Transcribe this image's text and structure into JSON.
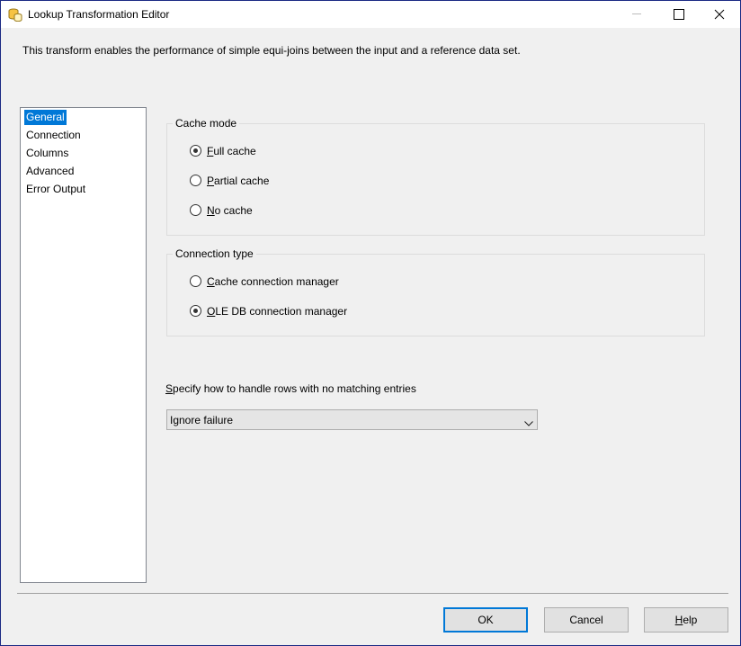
{
  "window": {
    "title": "Lookup Transformation Editor"
  },
  "description": "This transform enables the performance of simple equi-joins between the input and a reference data set.",
  "nav": {
    "items": [
      {
        "label": "General",
        "selected": true
      },
      {
        "label": "Connection",
        "selected": false
      },
      {
        "label": "Columns",
        "selected": false
      },
      {
        "label": "Advanced",
        "selected": false
      },
      {
        "label": "Error Output",
        "selected": false
      }
    ]
  },
  "cache_mode": {
    "legend": "Cache mode",
    "options": [
      {
        "label": "Full cache",
        "checked": true
      },
      {
        "label": "Partial cache",
        "checked": false
      },
      {
        "label": "No cache",
        "checked": false
      }
    ]
  },
  "connection_type": {
    "legend": "Connection type",
    "options": [
      {
        "label": "Cache connection manager",
        "checked": false
      },
      {
        "label": "OLE DB connection manager",
        "checked": true
      }
    ]
  },
  "no_match": {
    "label": "Specify how to handle rows with no matching entries",
    "value": "Ignore failure"
  },
  "buttons": {
    "ok": "OK",
    "cancel": "Cancel",
    "help": "Help"
  },
  "colors": {
    "selection": "#0078d7",
    "window_border": "#1b2a84",
    "background": "#f0f0f0"
  }
}
